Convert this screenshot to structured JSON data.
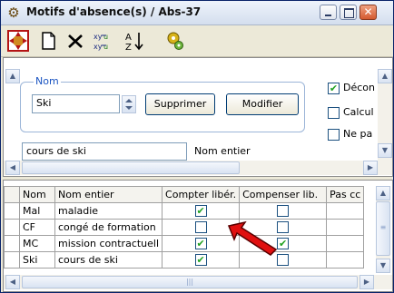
{
  "window": {
    "title": "Motifs d'absence(s) / Abs-37"
  },
  "form": {
    "group_label": "Nom",
    "name_value": "Ski",
    "delete_label": "Supprimer",
    "modify_label": "Modifier",
    "full_name_value": "cours de ski",
    "full_name_label": "Nom entier",
    "checkbox1_label": "Décon",
    "checkbox1_checked": true,
    "checkbox2_label": "Calcul",
    "checkbox3_label": "Ne pa"
  },
  "grid": {
    "headers": [
      "Nom",
      "Nom entier",
      "Compter libér.",
      "Compenser lib.",
      "Pas cc"
    ],
    "rows": [
      {
        "nom": "Mal",
        "nom_entier": "maladie",
        "compter": true,
        "compenser": false
      },
      {
        "nom": "CF",
        "nom_entier": "congé de formation",
        "compter": false,
        "compenser": false
      },
      {
        "nom": "MC",
        "nom_entier": "mission contractuell",
        "compter": true,
        "compenser": true
      },
      {
        "nom": "Ski",
        "nom_entier": "cours de ski",
        "compter": true,
        "compenser": false
      }
    ]
  },
  "colors": {
    "accent": "#1a54c2",
    "check": "#21a121",
    "arrow": "#e01010"
  }
}
